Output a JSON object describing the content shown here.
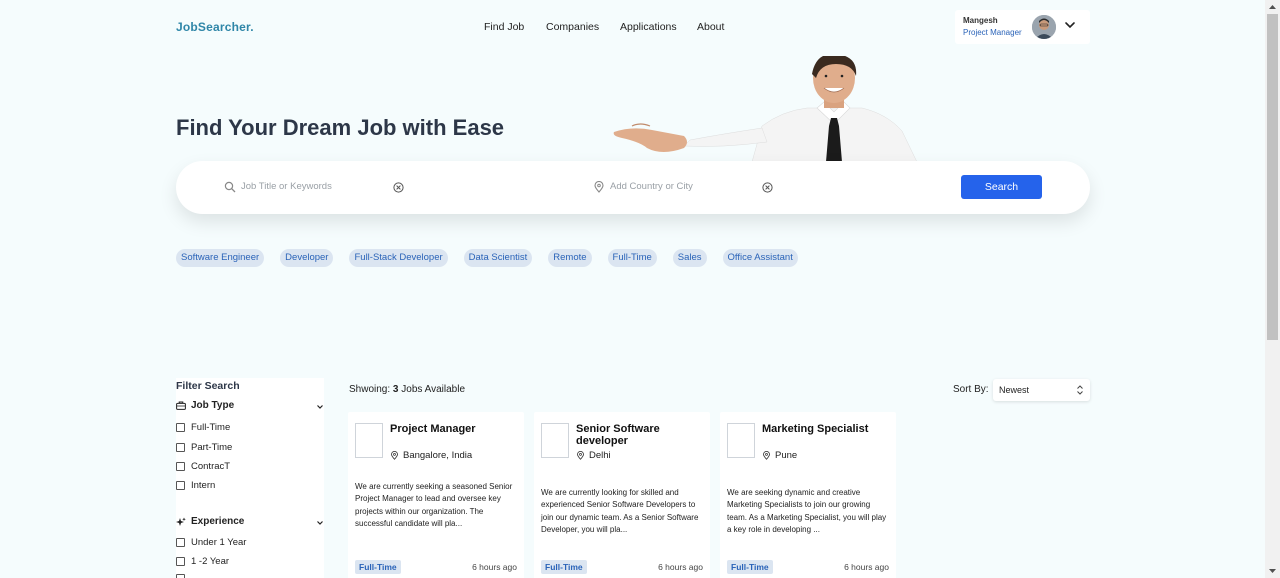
{
  "header": {
    "logo": "JobSearcher.",
    "nav": [
      "Find Job",
      "Companies",
      "Applications",
      "About"
    ],
    "user": {
      "name": "Mangesh",
      "role": "Project Manager"
    }
  },
  "hero": {
    "title": "Find Your Dream Job with Ease"
  },
  "search": {
    "keyword_placeholder": "Job Title or Keywords",
    "location_placeholder": "Add Country or City",
    "button": "Search"
  },
  "tags": [
    "Software Engineer",
    "Developer",
    "Full-Stack Developer",
    "Data Scientist",
    "Remote",
    "Full-Time",
    "Sales",
    "Office Assistant"
  ],
  "filter": {
    "title": "Filter Search",
    "job_type": {
      "title": "Job Type",
      "options": [
        "Full-Time",
        "Part-Time",
        "ContracT",
        "Intern"
      ]
    },
    "experience": {
      "title": "Experience",
      "options": [
        "Under 1 Year",
        "1 -2 Year"
      ]
    }
  },
  "results": {
    "showing_prefix": "Shwoing: ",
    "count": "3",
    "showing_suffix": " Jobs Available",
    "sort_label": "Sort By:",
    "sort_value": "Newest"
  },
  "jobs": [
    {
      "title": "Project Manager",
      "location": "Bangalore, India",
      "description": "We are currently seeking a seasoned Senior Project Manager to lead and oversee key projects within our organization. The successful candidate will pla...",
      "type": "Full-Time",
      "posted": "6 hours ago"
    },
    {
      "title": "Senior Software developer",
      "location": "Delhi",
      "description": "We are currently looking for skilled and experienced Senior Software Developers to join our dynamic team. As a Senior Software Developer, you will pla...",
      "type": "Full-Time",
      "posted": "6 hours ago"
    },
    {
      "title": "Marketing Specialist",
      "location": "Pune",
      "description": "We are seeking dynamic and creative Marketing Specialists to join our growing team. As a Marketing Specialist, you will play a key role in developing ...",
      "type": "Full-Time",
      "posted": "6 hours ago"
    }
  ],
  "colors": {
    "brand": "#2f86a8",
    "accent": "#2563eb",
    "tag_bg": "#dbe5f1",
    "tag_text": "#2a63b8",
    "page_bg": "#f5fcfd"
  },
  "icons": [
    "search-icon",
    "location-icon",
    "clear-icon",
    "chevron-down-icon",
    "briefcase-icon",
    "sparkle-icon",
    "sort-icon"
  ]
}
